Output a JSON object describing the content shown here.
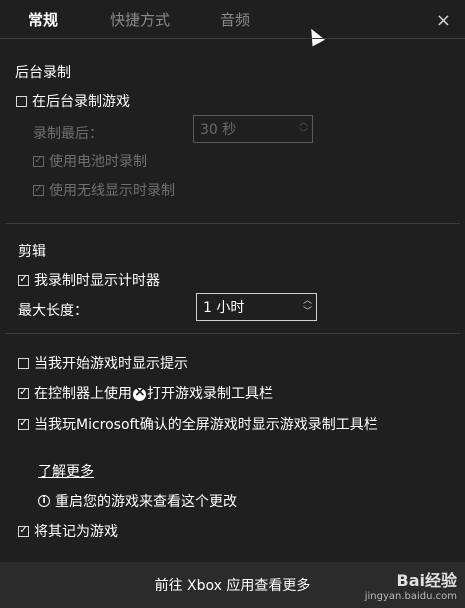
{
  "tabs": [
    {
      "label": "常规",
      "active": true
    },
    {
      "label": "快捷方式",
      "active": false
    },
    {
      "label": "音频",
      "active": false
    }
  ],
  "close_icon": "×",
  "background_recording": {
    "title": "后台录制",
    "record_in_background": {
      "label": "在后台录制游戏",
      "checked": false
    },
    "record_last_label": "录制最后：",
    "record_last_value": "30 秒",
    "battery": {
      "label": "使用电池时录制",
      "checked": true
    },
    "wireless": {
      "label": "使用无线显示时录制",
      "checked": true
    }
  },
  "clips": {
    "title": "剪辑",
    "show_timer": {
      "label": "我录制时显示计时器",
      "checked": true
    },
    "max_length_label": "最大长度：",
    "max_length_value": "1 小时"
  },
  "options": {
    "show_tips": {
      "label": "当我开始游戏时显示提示",
      "checked": false
    },
    "controller": {
      "label_before": "在控制器上使用",
      "label_after": "打开游戏录制工具栏",
      "checked": true
    },
    "fullscreen": {
      "label": "当我玩Microsoft确认的全屏游戏时显示游戏录制工具栏",
      "checked": true
    }
  },
  "learn_more": "了解更多",
  "restart_note": "重启您的游戏来查看这个更改",
  "remember_game": {
    "label": "将其记为游戏",
    "checked": true
  },
  "footer_text": "前往 Xbox 应用查看更多",
  "watermark": {
    "line1": "Bai经验",
    "line2": "jingyan.baidu.com"
  },
  "colors": {
    "background": "#1f1f1f",
    "text": "#ffffff",
    "disabled": "#6f6f6f",
    "footer": "#2b2b2b"
  }
}
